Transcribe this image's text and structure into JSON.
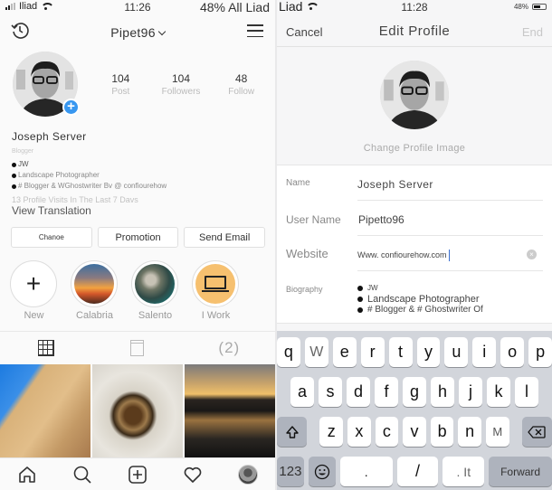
{
  "left": {
    "status": {
      "carrier": "Iliad",
      "time": "11:26",
      "right": "48% All Liad"
    },
    "header": {
      "username": "Pipet96",
      "history_icon": "history-icon",
      "menu_icon": "hamburger-menu-icon"
    },
    "stats": [
      {
        "value": "104",
        "label": "Post"
      },
      {
        "value": "104",
        "label": "Followers"
      },
      {
        "value": "48",
        "label": "Follow"
      }
    ],
    "profile": {
      "name": "Joseph Server",
      "category": "Blogger",
      "bio": [
        "JW",
        "Landscape Photographer",
        "# Blogger & WGhostwriter Bv @ confiourehow"
      ],
      "visits": "13 Profile Visits In The Last 7 Davs",
      "view_translation": "View Translation"
    },
    "buttons": {
      "change": "Chanoe",
      "promotion": "Promotion",
      "send_email": "Send Email"
    },
    "highlights": [
      {
        "label": "New",
        "icon": "plus-icon"
      },
      {
        "label": "Calabria"
      },
      {
        "label": "Salento"
      },
      {
        "label": "I Work",
        "icon": "laptop-icon"
      }
    ],
    "tabs": {
      "grid": "grid-icon",
      "feed": "feed-icon",
      "tagged": "(2)"
    },
    "nav": [
      "home-icon",
      "search-icon",
      "add-post-icon",
      "heart-icon",
      "profile-avatar"
    ]
  },
  "right": {
    "status": {
      "carrier": "Liad",
      "time": "11:28",
      "battery": "48%"
    },
    "header": {
      "cancel": "Cancel",
      "title": "Edit Profile",
      "end": "End"
    },
    "change_photo": "Change Profile Image",
    "form": {
      "name_label": "Name",
      "name_value": "Joseph Server",
      "username_label": "User Name",
      "username_value": "Pipetto96",
      "website_label": "Website",
      "website_value": "Www. confiourehow.com",
      "bio_label": "Biography",
      "bio_lines": [
        "JW",
        "Landscape Photographer",
        "# Blogger & # Ghostwriter Of"
      ]
    },
    "keyboard": {
      "row1": [
        "q",
        "W",
        "e",
        "r",
        "t",
        "y",
        "u",
        "i",
        "o",
        "p"
      ],
      "row2": [
        "a",
        "s",
        "d",
        "f",
        "g",
        "h",
        "j",
        "k",
        "l"
      ],
      "row3": [
        "z",
        "x",
        "c",
        "v",
        "b",
        "n",
        "M"
      ],
      "row4": {
        "num": "123",
        "dot": ".",
        "slash": "/",
        "it": ". It",
        "forward": "Forward"
      }
    }
  },
  "colors": {
    "accent": "#3897f0",
    "highlight_work": "#f6c06f",
    "keyboard_bg": "#d2d5db"
  }
}
